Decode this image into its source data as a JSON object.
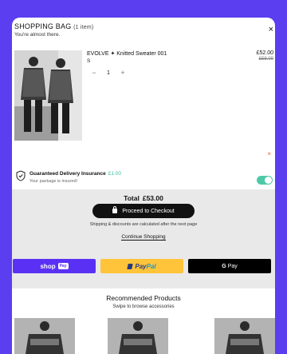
{
  "cart": {
    "title": "SHOPPING BAG",
    "item_count": "(1 item)",
    "subtitle": "You're almost there.",
    "close_glyph": "×"
  },
  "item": {
    "name": "EVOLVE ✦ Knitted Sweater 001",
    "size": "S",
    "price": "£52.00",
    "original_price": "£58.00",
    "quantity": "1",
    "minus_glyph": "−",
    "plus_glyph": "+",
    "remove_glyph": "×"
  },
  "insurance": {
    "title": "Guaranteed Delivery Insurance",
    "price": "£1.00",
    "subtitle": "Your package is insured!",
    "enabled": true
  },
  "summary": {
    "total_label": "Total",
    "total_amount": "£53.00",
    "checkout_label": "Proceed to Checkout",
    "shipping_note": "Shipping & discounts are calculated after the next page",
    "continue_label": "Continue Shopping"
  },
  "payments": {
    "shop_label": "shop",
    "shop_tag": "Pay",
    "paypal_1": "Pay",
    "paypal_2": "Pal",
    "gpay_g": "G",
    "gpay_label": "Pay"
  },
  "recommended": {
    "title": "Recommended Products",
    "subtitle": "Swipe to browse accessories"
  },
  "colors": {
    "background": "#5b3ef0",
    "shop_pay": "#5a31f4",
    "paypal": "#ffc439",
    "toggle_on": "#4ec9a8",
    "insurance_price": "#38c1a0",
    "remove": "#e0603c"
  },
  "icons": [
    "close-icon",
    "shield-icon",
    "lock-icon",
    "minus-icon",
    "plus-icon",
    "remove-icon",
    "paypal-icon",
    "google-icon"
  ]
}
